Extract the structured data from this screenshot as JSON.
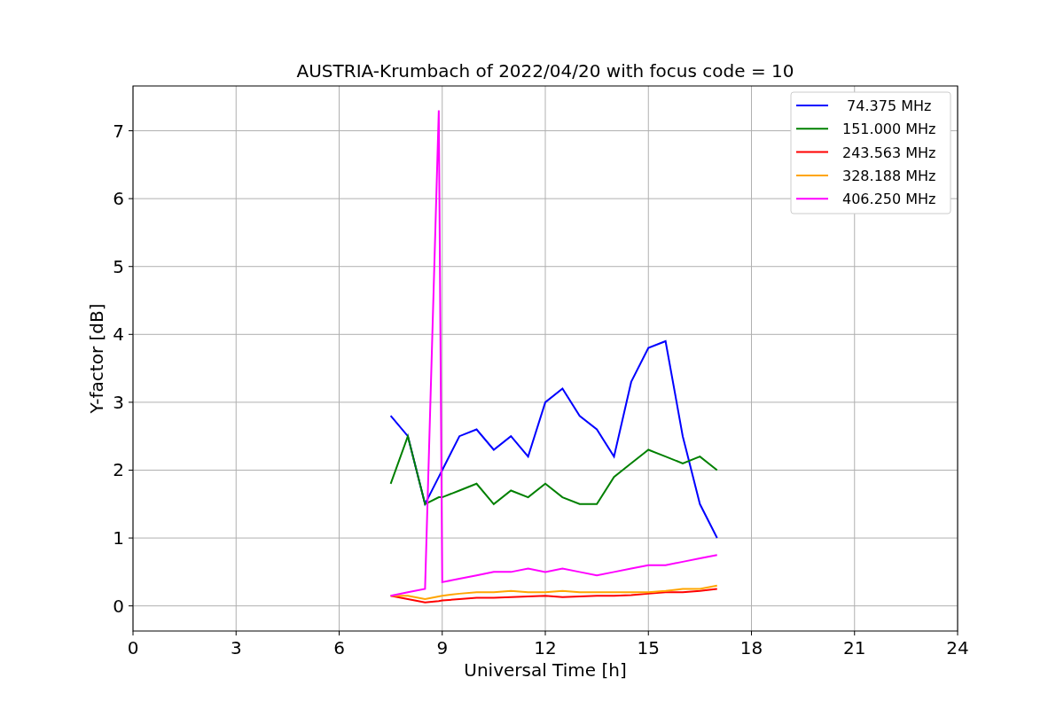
{
  "figure": {
    "chart_data": {
      "type": "line",
      "title": "AUSTRIA-Krumbach of 2022/04/20 with focus code = 10",
      "xlabel": "Universal Time [h]",
      "ylabel": "Y-factor [dB]",
      "x": [
        7.5,
        8,
        8.5,
        8.9,
        9,
        9.5,
        10,
        10.5,
        11,
        11.5,
        12,
        12.5,
        13,
        13.5,
        14,
        14.5,
        15,
        15.5,
        16,
        16.5,
        17
      ],
      "series": [
        {
          "name": " 74.375 MHz",
          "color": "#0000ff",
          "values": [
            2.8,
            2.5,
            1.5,
            1.9,
            2.0,
            2.5,
            2.6,
            2.3,
            2.5,
            2.2,
            3.0,
            3.2,
            2.8,
            2.6,
            2.2,
            3.3,
            3.8,
            3.9,
            2.5,
            1.5,
            1.0
          ]
        },
        {
          "name": "151.000 MHz",
          "color": "#008000",
          "values": [
            1.8,
            2.5,
            1.5,
            1.6,
            1.6,
            1.7,
            1.8,
            1.5,
            1.7,
            1.6,
            1.8,
            1.6,
            1.5,
            1.5,
            1.9,
            2.1,
            2.3,
            2.2,
            2.1,
            2.2,
            2.0
          ]
        },
        {
          "name": "243.563 MHz",
          "color": "#ff0000",
          "values": [
            0.15,
            0.1,
            0.05,
            0.07,
            0.08,
            0.1,
            0.12,
            0.12,
            0.13,
            0.14,
            0.15,
            0.13,
            0.14,
            0.15,
            0.15,
            0.16,
            0.18,
            0.2,
            0.2,
            0.22,
            0.25
          ]
        },
        {
          "name": "328.188 MHz",
          "color": "#ffa500",
          "values": [
            0.15,
            0.15,
            0.1,
            0.14,
            0.15,
            0.18,
            0.2,
            0.2,
            0.22,
            0.2,
            0.2,
            0.22,
            0.2,
            0.2,
            0.2,
            0.2,
            0.2,
            0.22,
            0.25,
            0.25,
            0.3
          ]
        },
        {
          "name": "406.250 MHz",
          "color": "#ff00ff",
          "values": [
            0.15,
            0.2,
            0.25,
            7.3,
            0.35,
            0.4,
            0.45,
            0.5,
            0.5,
            0.55,
            0.5,
            0.55,
            0.5,
            0.45,
            0.5,
            0.55,
            0.6,
            0.6,
            0.65,
            0.7,
            0.75
          ]
        }
      ],
      "xlim": [
        0,
        24
      ],
      "ylim": [
        -0.37,
        7.66
      ],
      "xticks": [
        0,
        3,
        6,
        9,
        12,
        15,
        18,
        21,
        24
      ],
      "yticks": [
        0,
        1,
        2,
        3,
        4,
        5,
        6,
        7
      ],
      "grid": true,
      "legend": true
    }
  }
}
